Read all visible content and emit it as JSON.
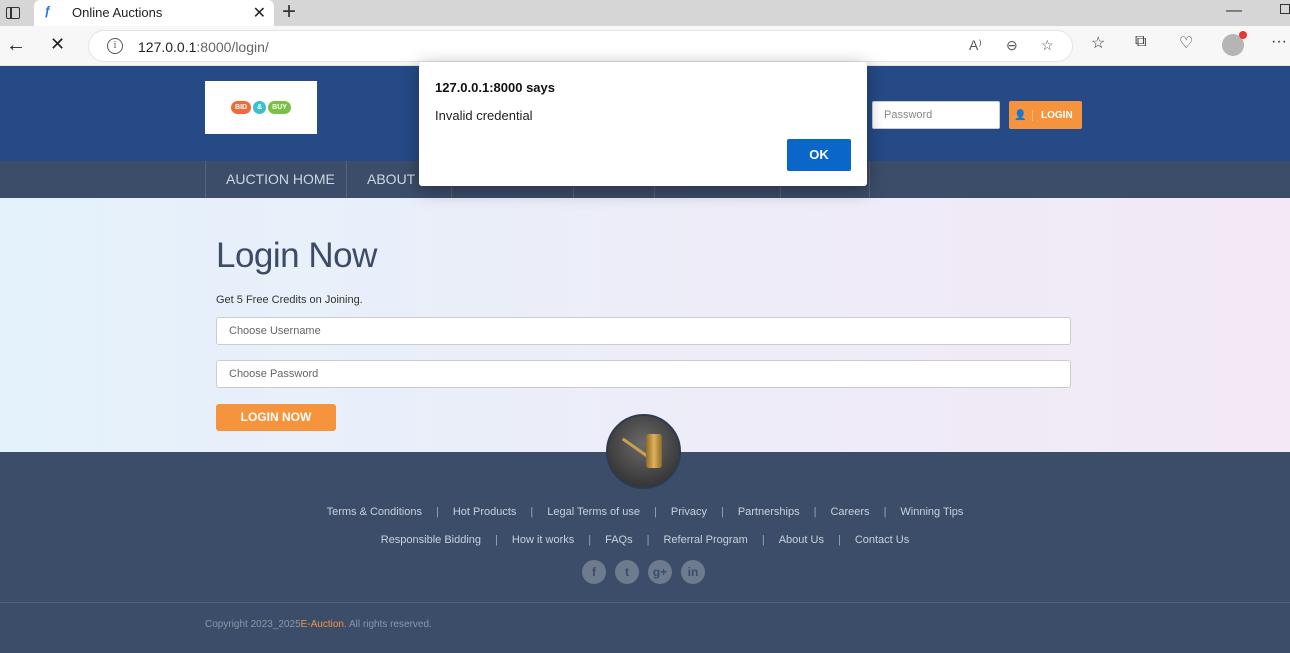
{
  "browser": {
    "tab_title": "Online Auctions",
    "url_host": "127.0.0.1",
    "url_rest": ":8000/login/"
  },
  "header": {
    "logo_words": [
      "BID",
      "&",
      "BUY"
    ],
    "password_placeholder": "Password",
    "login_label": "LOGIN",
    "nav": [
      "AUCTION HOME",
      "ABOUT U"
    ]
  },
  "main": {
    "title": "Login Now",
    "subtitle": "Get 5 Free Credits on Joining.",
    "username_placeholder": "Choose Username",
    "password_placeholder": "Choose Password",
    "submit_label": "LOGIN NOW"
  },
  "footer": {
    "links_row1": [
      "Terms & Conditions",
      "Hot Products",
      "Legal Terms of use",
      "Privacy",
      "Partnerships",
      "Careers",
      "Winning Tips"
    ],
    "links_row2": [
      "Responsible Bidding",
      "How it works",
      "FAQs",
      "Referral Program",
      "About Us",
      "Contact Us"
    ],
    "social": [
      "f",
      "t",
      "g+",
      "in"
    ],
    "copyright_prefix": "Copyright 2023_2025",
    "copyright_brand": "E-Auction",
    "copyright_suffix": ". All rights reserved."
  },
  "dialog": {
    "title": "127.0.0.1:8000 says",
    "message": "Invalid credential",
    "ok_label": "OK"
  },
  "colors": {
    "header_bg": "#254a86",
    "nav_bg": "#3b4d69",
    "accent": "#f6943e",
    "dialog_button": "#0a66c8"
  }
}
